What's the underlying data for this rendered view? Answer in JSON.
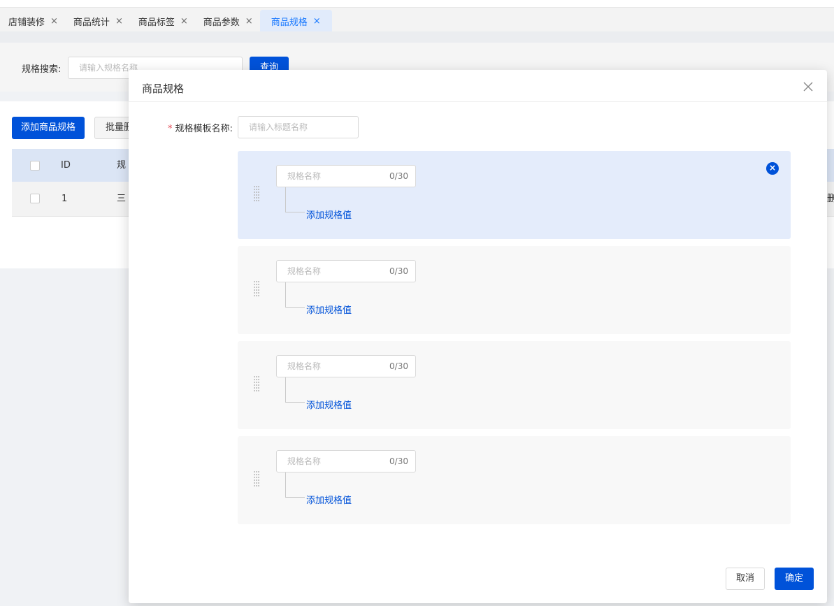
{
  "tabs": [
    {
      "label": "店铺装修",
      "close": "×"
    },
    {
      "label": "商品统计",
      "close": "×"
    },
    {
      "label": "商品标签",
      "close": "×"
    },
    {
      "label": "商品参数",
      "close": "×"
    },
    {
      "label": "商品规格",
      "close": "×",
      "active": true
    }
  ],
  "search": {
    "label": "规格搜索:",
    "placeholder": "请输入规格名称",
    "button": "查询"
  },
  "toolbar": {
    "add_label": "添加商品规格",
    "batch_label": "批量删"
  },
  "table": {
    "headers": [
      "ID",
      "规"
    ],
    "rows": [
      {
        "id": "1",
        "name": "三",
        "trailing": "删"
      }
    ]
  },
  "dialog": {
    "title": "商品规格",
    "close_icon": "close-icon",
    "template_name_label": "规格模板名称:",
    "template_name_required": "*",
    "template_name_placeholder": "请输入标题名称",
    "specs": [
      {
        "name_placeholder": "规格名称",
        "counter": "0/30",
        "add_value_label": "添加规格值",
        "active": true
      },
      {
        "name_placeholder": "规格名称",
        "counter": "0/30",
        "add_value_label": "添加规格值",
        "active": false
      },
      {
        "name_placeholder": "规格名称",
        "counter": "0/30",
        "add_value_label": "添加规格值",
        "active": false
      },
      {
        "name_placeholder": "规格名称",
        "counter": "0/30",
        "add_value_label": "添加规格值",
        "active": false
      }
    ],
    "cancel_label": "取消",
    "confirm_label": "确定"
  },
  "colors": {
    "primary": "#0052d9",
    "active_block": "#e4ecfb",
    "required": "#e34d59"
  }
}
